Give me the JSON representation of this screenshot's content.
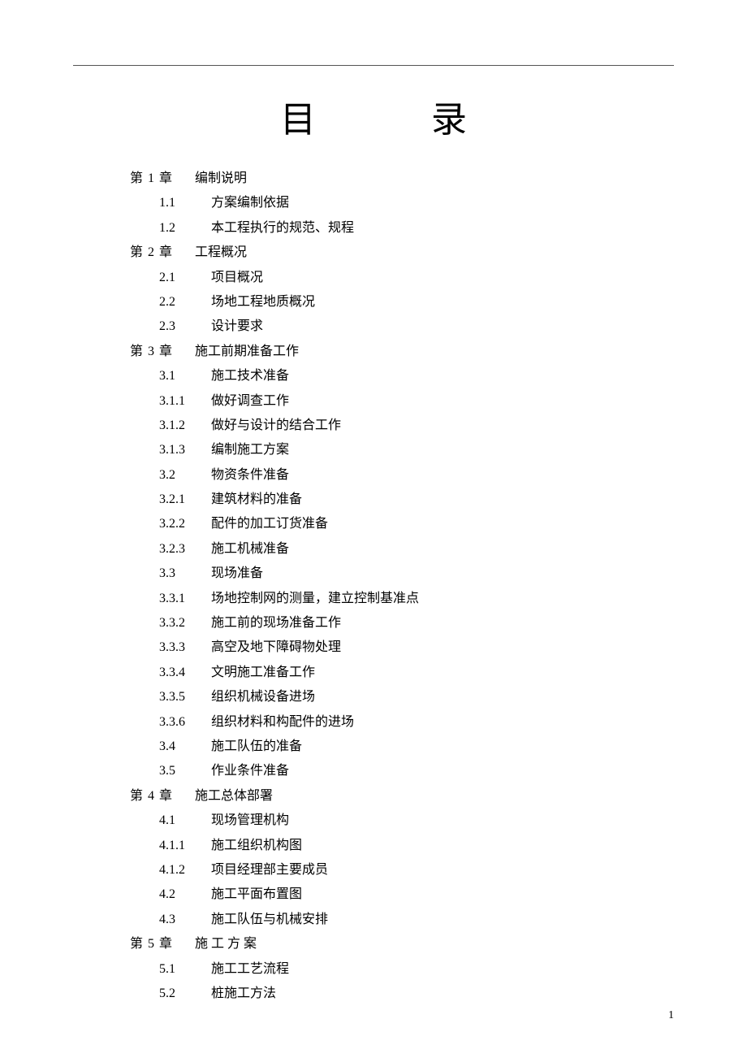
{
  "title_left": "目",
  "title_right": "录",
  "page_number": "1",
  "toc": [
    {
      "type": "chapter",
      "num": "第 1 章",
      "text": "编制说明"
    },
    {
      "type": "sub",
      "num": "1.1",
      "text": "方案编制依据"
    },
    {
      "type": "sub",
      "num": "1.2",
      "text": "本工程执行的规范、规程"
    },
    {
      "type": "chapter",
      "num": "第 2 章",
      "text": "工程概况"
    },
    {
      "type": "sub",
      "num": "2.1",
      "text": "项目概况"
    },
    {
      "type": "sub",
      "num": "2.2",
      "text": "场地工程地质概况"
    },
    {
      "type": "sub",
      "num": "2.3",
      "text": "设计要求"
    },
    {
      "type": "chapter",
      "num": "第 3 章",
      "text": "施工前期准备工作"
    },
    {
      "type": "sub",
      "num": "3.1",
      "text": "施工技术准备"
    },
    {
      "type": "subsub",
      "num": "3.1.1",
      "text": "做好调查工作"
    },
    {
      "type": "subsub",
      "num": "3.1.2",
      "text": "做好与设计的结合工作"
    },
    {
      "type": "subsub",
      "num": "3.1.3",
      "text": "编制施工方案"
    },
    {
      "type": "sub",
      "num": "3.2",
      "text": "物资条件准备"
    },
    {
      "type": "subsub",
      "num": "3.2.1",
      "text": "建筑材料的准备"
    },
    {
      "type": "subsub",
      "num": "3.2.2",
      "text": "配件的加工订货准备"
    },
    {
      "type": "subsub",
      "num": "3.2.3",
      "text": "施工机械准备"
    },
    {
      "type": "sub",
      "num": "3.3",
      "text": "现场准备"
    },
    {
      "type": "subsub",
      "num": "3.3.1",
      "text": "场地控制网的测量，建立控制基准点"
    },
    {
      "type": "subsub",
      "num": "3.3.2",
      "text": "施工前的现场准备工作"
    },
    {
      "type": "subsub",
      "num": "3.3.3",
      "text": "高空及地下障碍物处理"
    },
    {
      "type": "subsub",
      "num": "3.3.4",
      "text": "文明施工准备工作"
    },
    {
      "type": "subsub",
      "num": "3.3.5",
      "text": "组织机械设备进场"
    },
    {
      "type": "subsub",
      "num": "3.3.6",
      "text": "组织材料和构配件的进场"
    },
    {
      "type": "sub",
      "num": "3.4",
      "text": "施工队伍的准备"
    },
    {
      "type": "sub",
      "num": "3.5",
      "text": "作业条件准备"
    },
    {
      "type": "chapter",
      "num": "第 4 章",
      "text": "施工总体部署"
    },
    {
      "type": "sub",
      "num": "4.1",
      "text": "现场管理机构"
    },
    {
      "type": "subsub",
      "num": "4.1.1",
      "text": "施工组织机构图"
    },
    {
      "type": "subsub",
      "num": "4.1.2",
      "text": "项目经理部主要成员"
    },
    {
      "type": "sub",
      "num": "4.2",
      "text": "施工平面布置图"
    },
    {
      "type": "sub",
      "num": "4.3",
      "text": "施工队伍与机械安排"
    },
    {
      "type": "chapter",
      "num": "第 5 章",
      "text": "施 工 方 案"
    },
    {
      "type": "sub",
      "num": "5.1",
      "text": "施工工艺流程"
    },
    {
      "type": "sub",
      "num": "5.2",
      "text": "桩施工方法"
    }
  ]
}
